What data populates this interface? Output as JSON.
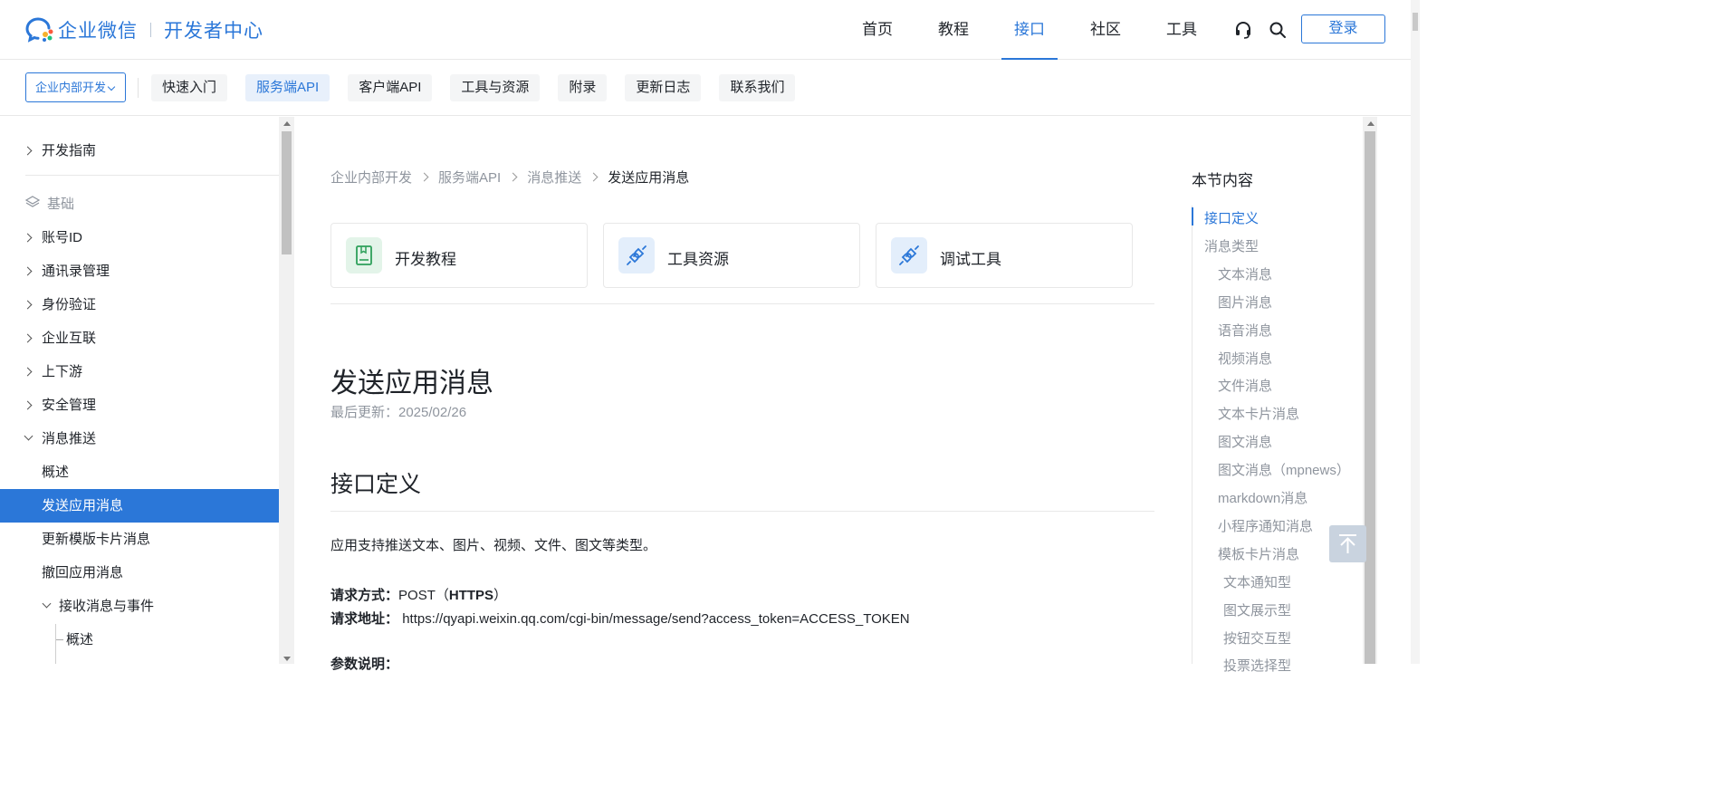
{
  "header": {
    "brand": "企业微信",
    "subtitle": "开发者中心",
    "nav": [
      "首页",
      "教程",
      "接口",
      "社区",
      "工具"
    ],
    "active_nav_index": 2,
    "login_label": "登录",
    "icons": [
      "headset-icon",
      "search-icon"
    ]
  },
  "subnav": {
    "scope_label": "企业内部开发",
    "chips": [
      "快速入门",
      "服务端API",
      "客户端API",
      "工具与资源",
      "附录",
      "更新日志",
      "联系我们"
    ],
    "active_chip_index": 1
  },
  "sidebar": {
    "guide": "开发指南",
    "group": "基础",
    "items": [
      "账号ID",
      "通讯录管理",
      "身份验证",
      "企业互联",
      "上下游",
      "安全管理"
    ],
    "expanded": "消息推送",
    "children": [
      "概述",
      "发送应用消息",
      "更新模版卡片消息",
      "撤回应用消息"
    ],
    "sub_expanded": "接收消息与事件",
    "sub_children": [
      "概述"
    ],
    "active": "发送应用消息"
  },
  "breadcrumb": [
    "企业内部开发",
    "服务端API",
    "消息推送",
    "发送应用消息"
  ],
  "cards": [
    {
      "label": "开发教程",
      "icon": "book-icon",
      "color": "#2ea05a",
      "bg": "#e3f4e9"
    },
    {
      "label": "工具资源",
      "icon": "plug-icon",
      "color": "#2b77d8",
      "bg": "#e3eefb"
    },
    {
      "label": "调试工具",
      "icon": "plug-icon",
      "color": "#2b77d8",
      "bg": "#e3eefb"
    }
  ],
  "article": {
    "title": "发送应用消息",
    "updated": "最后更新：2025/02/26",
    "section": "接口定义",
    "intro": "应用支持推送文本、图片、视频、文件、图文等类型。",
    "method_label": "请求方式：",
    "method_value_prefix": "POST（",
    "method_value_bold": "HTTPS",
    "method_value_suffix": "）",
    "url_label": "请求地址：",
    "url_value": "https://qyapi.weixin.qq.com/cgi-bin/message/send?access_token=ACCESS_TOKEN",
    "params_label": "参数说明："
  },
  "toc": {
    "title": "本节内容",
    "items": [
      {
        "label": "接口定义",
        "level": 0,
        "active": true
      },
      {
        "label": "消息类型",
        "level": 0
      },
      {
        "label": "文本消息",
        "level": 1
      },
      {
        "label": "图片消息",
        "level": 1
      },
      {
        "label": "语音消息",
        "level": 1
      },
      {
        "label": "视频消息",
        "level": 1
      },
      {
        "label": "文件消息",
        "level": 1
      },
      {
        "label": "文本卡片消息",
        "level": 1
      },
      {
        "label": "图文消息",
        "level": 1
      },
      {
        "label": "图文消息（mpnews）",
        "level": 1
      },
      {
        "label": "markdown消息",
        "level": 1
      },
      {
        "label": "小程序通知消息",
        "level": 1
      },
      {
        "label": "模板卡片消息",
        "level": 1
      },
      {
        "label": "文本通知型",
        "level": 2
      },
      {
        "label": "图文展示型",
        "level": 2
      },
      {
        "label": "按钮交互型",
        "level": 2
      },
      {
        "label": "投票选择型",
        "level": 2
      }
    ]
  },
  "colors": {
    "accent": "#2b77d8",
    "muted": "#8f959e",
    "text": "#1f2329"
  }
}
